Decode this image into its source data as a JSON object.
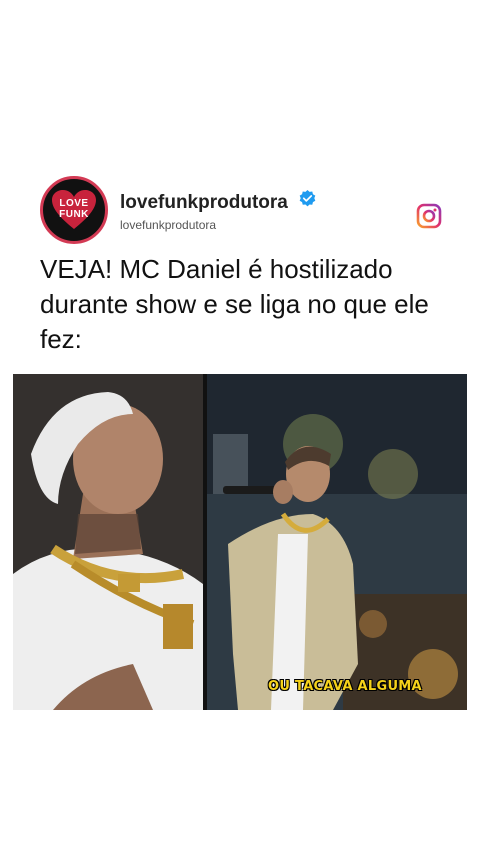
{
  "post": {
    "avatar_text_line1": "LOVE",
    "avatar_text_line2": "FUNK",
    "username": "lovefunkprodutora",
    "handle": "lovefunkprodutora",
    "headline": "VEJA! MC Daniel é hostilizado durante show e se liga no que ele fez:",
    "video_caption": "OU TACAVA ALGUMA"
  },
  "colors": {
    "avatar_ring": "#d33a54",
    "verified_badge": "#1f9bf0",
    "instagram_accent": "#d6249f",
    "caption_yellow": "#f5d21a"
  },
  "icons": {
    "verified": "verified-badge-icon",
    "instagram": "instagram-icon"
  }
}
